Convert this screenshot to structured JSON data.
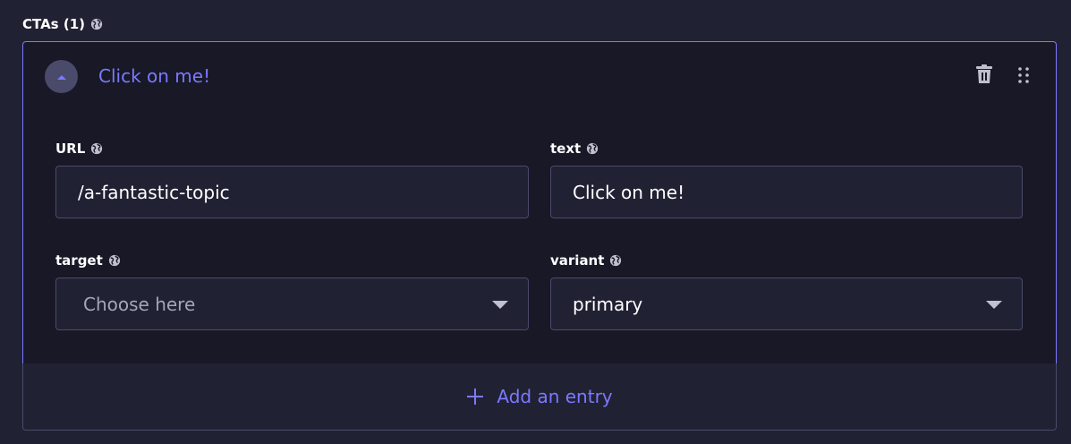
{
  "section": {
    "label": "CTAs (1)"
  },
  "entry": {
    "title": "Click on me!",
    "fields": {
      "url": {
        "label": "URL",
        "value": "/a-fantastic-topic"
      },
      "text": {
        "label": "text",
        "value": "Click on me!"
      },
      "target": {
        "label": "target",
        "placeholder": "Choose here"
      },
      "variant": {
        "label": "variant",
        "value": "primary"
      }
    }
  },
  "add_entry": {
    "label": "Add an entry"
  },
  "icons": {
    "globe": "globe-icon",
    "toggle": "chevron-up-icon",
    "delete": "trash-icon",
    "drag": "drag-handle-icon",
    "add": "plus-icon",
    "dropdown": "caret-down-icon"
  },
  "colors": {
    "accent": "#7b79ff",
    "background": "#212134",
    "card": "#181826",
    "border": "#4a4a6a"
  }
}
